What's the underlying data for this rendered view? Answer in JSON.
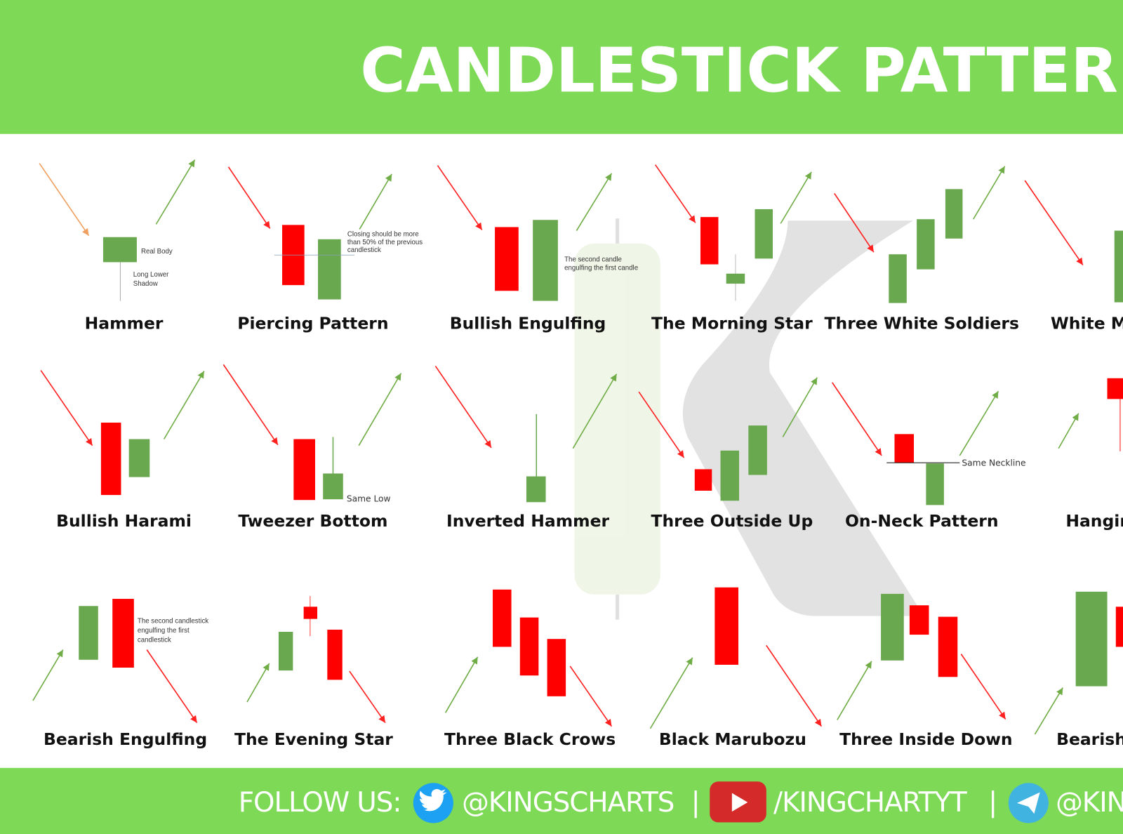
{
  "header": {
    "title": "CANDLESTICK PATTERNS",
    "background": "#7ED957"
  },
  "colors": {
    "bullish": "#6AA84F",
    "bearish": "#FF0000"
  },
  "patterns": {
    "row1": [
      {
        "name": "Hammer",
        "notes": [
          "Real Body",
          "Long Lower",
          "Shadow"
        ]
      },
      {
        "name": "Piercing Pattern",
        "notes": [
          "Closing should be more",
          "than 50% of the previous",
          "candlestick"
        ]
      },
      {
        "name": "Bullish Engulfing",
        "notes": [
          "The second candle",
          "engulfing the first candle"
        ]
      },
      {
        "name": "The Morning Star"
      },
      {
        "name": "Three White Soldiers"
      },
      {
        "name": "White M"
      }
    ],
    "row2": [
      {
        "name": "Bullish Harami"
      },
      {
        "name": "Tweezer Bottom",
        "notes": [
          "Same Low"
        ]
      },
      {
        "name": "Inverted Hammer"
      },
      {
        "name": "Three Outside Up"
      },
      {
        "name": "On-Neck Pattern",
        "notes": [
          "Same Neckline"
        ]
      },
      {
        "name": "Hangin"
      }
    ],
    "row3": [
      {
        "name": "Bearish Engulfing",
        "notes": [
          "The second candlestick",
          "engulfing the first",
          "candlestick"
        ]
      },
      {
        "name": "The Evening Star"
      },
      {
        "name": "Three Black Crows"
      },
      {
        "name": "Black Marubozu"
      },
      {
        "name": "Three Inside Down"
      },
      {
        "name": "Bearish"
      }
    ]
  },
  "footer": {
    "label": "FOLLOW US:",
    "twitter": {
      "icon": "twitter-icon",
      "handle": "@KINGSCHARTS"
    },
    "youtube": {
      "icon": "youtube-icon",
      "handle": "/KINGCHARTYT"
    },
    "telegram": {
      "icon": "telegram-icon",
      "handle": "@KIN"
    },
    "separator": "|"
  }
}
